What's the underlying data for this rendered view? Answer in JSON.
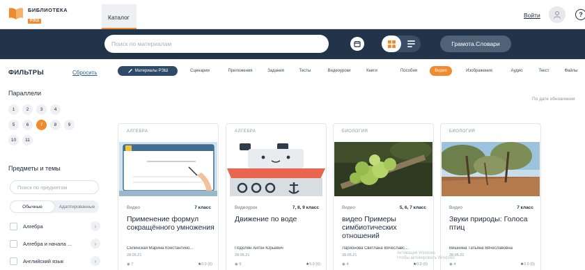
{
  "header": {
    "logo_line1": "БИБЛИОТЕКА",
    "logo_line2": "РЭШ",
    "tab_catalog": "Каталог",
    "login": "Войти",
    "help": "?"
  },
  "search": {
    "placeholder": "Поиск по материалам",
    "gramota_button": "Грамота.Словари"
  },
  "sidebar": {
    "title": "ФИЛЬТРЫ",
    "reset": "Сбросить",
    "grades_label": "Параллели",
    "grades": [
      "1",
      "2",
      "3",
      "4",
      "5",
      "6",
      "7",
      "8",
      "9",
      "10",
      "11"
    ],
    "active_grade": "7",
    "subjects_label": "Предметы и темы",
    "subjects_placeholder": "Поиск по предметам",
    "seg_regular": "Обычные",
    "seg_adapted": "Адаптированные",
    "subjects": [
      "Алгебра",
      "Алгебра и начала ...",
      "Английский язык"
    ]
  },
  "chips": [
    "Материалы РЭШ",
    "Сценарии",
    "Приложения",
    "Задания",
    "Тесты",
    "Видеоуроки",
    "Книги",
    "Пособия",
    "Видео",
    "Изображения",
    "Аудио",
    "Текст",
    "Файлы"
  ],
  "active_chip": "Видео",
  "sort_label": "По дате обновления",
  "cards": [
    {
      "subject": "АЛГЕБРА",
      "type": "Видео",
      "grade": "7 класс",
      "title": "Применение формул сокращённого умножения",
      "author": "Селинская Марина Константино...",
      "date": "28.05.21",
      "views": "7",
      "rating": "0.0 (0)"
    },
    {
      "subject": "АЛГЕБРА",
      "type": "Видеоурок",
      "grade": "7, 8, 9 класс",
      "title": "Движение по воде",
      "author": "Подолян Антон Юрьевич",
      "date": "28.05.21",
      "views": "9",
      "rating": "5.0 (0)"
    },
    {
      "subject": "БИОЛОГИЯ",
      "type": "Видео",
      "grade": "5, 6, 7 класс",
      "title": "видео Примеры симбиотических отношений",
      "author": "Ларионова Светлана Вячеславс...",
      "date": "28.05.21",
      "views": "4",
      "rating": "0.0 (0)"
    },
    {
      "subject": "БИОЛОГИЯ",
      "type": "Видео",
      "grade": "7 класс",
      "title": "Звуки природы: Голоса птиц",
      "author": "Вишнина Татьяна Вячеславовна",
      "date": "28.05.21",
      "views": "4",
      "rating": "0.0 (0)"
    }
  ],
  "watermark": {
    "line1": "Активация Windows",
    "line2": "Чтобы активировать Windows"
  },
  "colors": {
    "accent": "#f08a2c",
    "navy": "#213449",
    "chip_dark": "#2f4a69"
  }
}
